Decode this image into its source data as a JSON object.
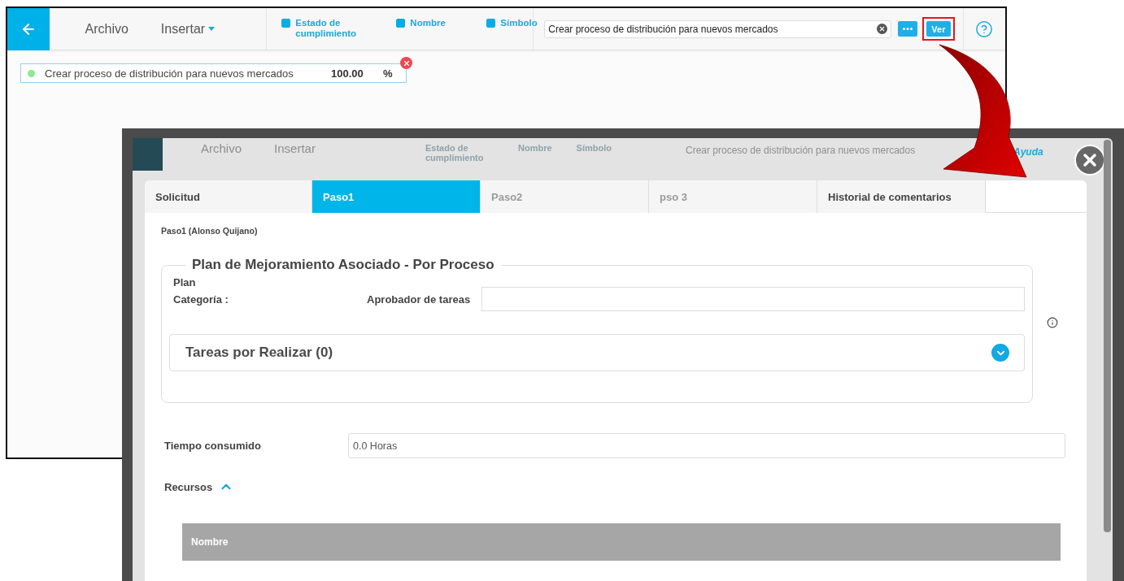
{
  "main_window": {
    "menu": [
      {
        "label": "Archivo",
        "has_dropdown": false
      },
      {
        "label": "Insertar",
        "has_dropdown": true
      }
    ],
    "fields": [
      {
        "label": "Estado de cumplimiento",
        "checked": true
      },
      {
        "label": "Nombre",
        "checked": true
      },
      {
        "label": "Símbolo",
        "checked": true
      }
    ],
    "search": {
      "value": "Crear proceso de distribución para nuevos mercados"
    },
    "view_button": {
      "label": "Ver",
      "highlighted": true
    },
    "chip": {
      "label": "Crear proceso de distribución para nuevos mercados",
      "value": "100.00",
      "unit": "%"
    }
  },
  "modal": {
    "background_header": {
      "menu": [
        "Archivo",
        "Insertar"
      ],
      "fields": [
        "Estado de cumplimiento",
        "Nombre",
        "Símbolo"
      ],
      "search_value": "Crear proceso de distribución para nuevos mercados",
      "help_link": "Ayuda"
    },
    "tabs": [
      {
        "label": "Solicitud",
        "selected": false,
        "disabled": false
      },
      {
        "label": "Paso1",
        "selected": true,
        "disabled": false
      },
      {
        "label": "Paso2",
        "selected": false,
        "disabled": true
      },
      {
        "label": "pso 3",
        "selected": false,
        "disabled": true
      },
      {
        "label": "Historial de comentarios",
        "selected": false,
        "disabled": false
      }
    ],
    "step_title": "Paso1 (Alonso Quijano)",
    "section": {
      "legend": "Plan de Mejoramiento Asociado - Por Proceso",
      "plan_label": "Plan",
      "category_label": "Categoría :",
      "approver_label": "Aprobador de tareas",
      "tasks": {
        "title": "Tareas por Realizar (0)",
        "expanded": false
      }
    },
    "time": {
      "label": "Tiempo consumido",
      "value": "0.0 Horas"
    },
    "resources": {
      "label": "Recursos",
      "expanded": true,
      "columns": [
        "Nombre"
      ]
    }
  }
}
